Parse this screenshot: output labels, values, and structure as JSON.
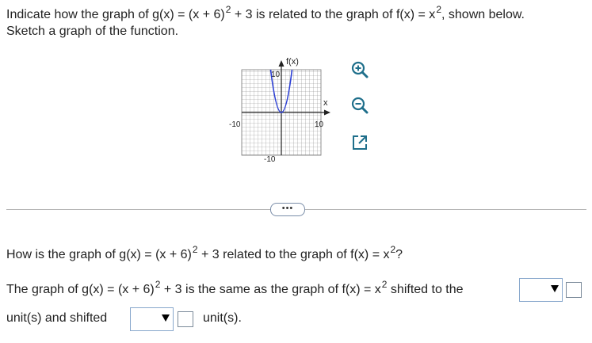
{
  "question": {
    "line1_part1": "Indicate how the graph of g(x) = (x + 6)",
    "line1_exp1": "2",
    "line1_part2": " + 3 is related to the graph of f(x) = x",
    "line1_exp2": "2",
    "line1_part3": ", shown below.",
    "line2": "Sketch a graph of the function."
  },
  "graph": {
    "y_axis_label": "f(x)",
    "x_axis_label": "x",
    "tick_y_top": "10",
    "tick_y_bottom": "-10",
    "tick_x_left": "-10",
    "tick_x_right": "10",
    "curve_color": "#2c3fd6"
  },
  "tools": {
    "zoom_in_icon": "zoom-in-icon",
    "zoom_out_icon": "zoom-out-icon",
    "popout_icon": "popout-icon"
  },
  "more_label": "•••",
  "sub_question": {
    "part1": "How is the graph of g(x) = (x + 6)",
    "exp1": "2",
    "part2": " + 3 related to the graph of f(x) = x",
    "exp2": "2",
    "part3": "?"
  },
  "answer": {
    "part1": "The graph of g(x) = (x + 6)",
    "exp1": "2",
    "part2": " + 3 is the same as the graph of f(x) = x",
    "exp2": "2",
    "part3": " shifted to the",
    "line2_part1": "unit(s) and shifted",
    "line2_part2": "unit(s).",
    "dropdown1_value": "",
    "dropdown2_value": "",
    "input1_value": "",
    "input2_value": ""
  }
}
